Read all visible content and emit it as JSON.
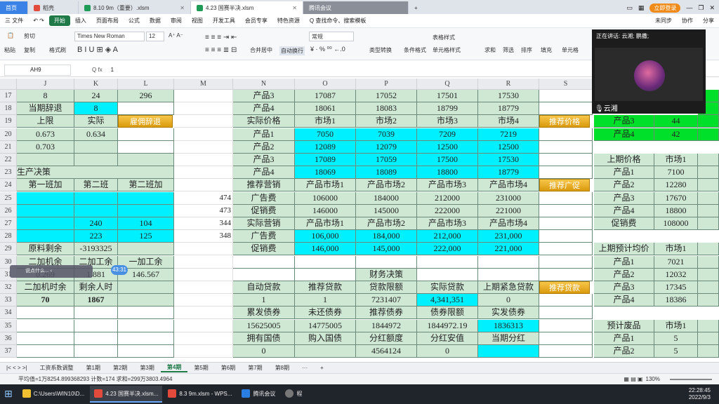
{
  "titlebar": {
    "tabs": [
      {
        "label": "首页"
      },
      {
        "label": "稻壳"
      },
      {
        "label": "8.10 9m（重要）.xlsm"
      },
      {
        "label": "4.23 国赛半决.xlsm"
      },
      {
        "label": "腾讯会议"
      }
    ],
    "login_label": "立即登录"
  },
  "menubar": {
    "items": [
      "三 文件",
      "开始",
      "插入",
      "页面布局",
      "公式",
      "数据",
      "审阅",
      "视图",
      "开发工具",
      "会员专享",
      "特色资源",
      "Q 查找命令、搜索模板",
      "未同步",
      "协作",
      "分享"
    ]
  },
  "ribbon": {
    "font_name": "Times New Roman",
    "font_size": "12",
    "number_format": "常规",
    "labels": [
      "剪切",
      "复制",
      "格式刷",
      "粘贴",
      "合并居中",
      "自动换行",
      "条件格式",
      "表格样式",
      "单元格样式",
      "求和",
      "筛选",
      "排序",
      "填充",
      "单元格",
      "类型转换"
    ]
  },
  "formula": {
    "cell_ref": "AH9",
    "value": "1"
  },
  "columns": [
    "J",
    "K",
    "L",
    "M",
    "N",
    "O",
    "P",
    "Q",
    "R",
    "S"
  ],
  "rows": [
    "17",
    "18",
    "19",
    "20",
    "21",
    "22",
    "23",
    "24",
    "25",
    "26",
    "27",
    "28",
    "29",
    "30",
    "31",
    "32",
    "33",
    "34",
    "35",
    "36",
    "37"
  ],
  "cells": {
    "J17": "8",
    "K17": "24",
    "L17": "296",
    "N17": "产品3",
    "O17": "17087",
    "P17": "17052",
    "Q17": "17501",
    "R17": "17530",
    "J18": "当期辞退",
    "K18": "8",
    "N18": "产品4",
    "O18": "18061",
    "P18": "18083",
    "Q18": "18799",
    "R18": "18779",
    "J19": "上限",
    "K19": "实际",
    "N19": "实际价格",
    "O19": "市场1",
    "P19": "市场2",
    "Q19": "市场3",
    "R19": "市场4",
    "J20": "0.673",
    "K20": "0.634",
    "N20": "产品1",
    "O20": "7050",
    "P20": "7039",
    "Q20": "7209",
    "R20": "7219",
    "J21": "0.703",
    "N21": "产品2",
    "O21": "12089",
    "P21": "12079",
    "Q21": "12500",
    "R21": "12500",
    "N22": "产品3",
    "O22": "17089",
    "P22": "17059",
    "Q22": "17500",
    "R22": "17530",
    "J23": "生产决策",
    "N23": "产品4",
    "O23": "18069",
    "P23": "18089",
    "Q23": "18800",
    "R23": "18779",
    "J24": "第一班加",
    "K24": "第二班",
    "L24": "第二班加",
    "N24": "推荐营销",
    "O24": "产品市场1",
    "P24": "产品市场2",
    "Q24": "产品市场3",
    "R24": "产品市场4",
    "M25": "474",
    "N25": "广告费",
    "O25": "106000",
    "P25": "184000",
    "Q25": "212000",
    "R25": "231000",
    "M26": "473",
    "N26": "促销费",
    "O26": "146000",
    "P26": "145000",
    "Q26": "222000",
    "R26": "221000",
    "K27": "240",
    "L27": "104",
    "M27": "344",
    "N27": "实际营销",
    "O27": "产品市场1",
    "P27": "产品市场2",
    "Q27": "产品市场3",
    "R27": "产品市场4",
    "K28": "223",
    "L28": "125",
    "M28": "348",
    "N28": "广告费",
    "O28": "106,000",
    "P28": "184,000",
    "Q28": "212,000",
    "R28": "231,000",
    "J29": "原料剩余",
    "K29": "-3193325",
    "N29": "促销费",
    "O29": "146,000",
    "P29": "145,000",
    "Q29": "222,000",
    "R29": "221,000",
    "J30": "二加机余",
    "K30": "二加工余",
    "L30": "一加工余",
    "J31": "0.269",
    "K31": "1.881",
    "L31": "146.567",
    "P31": "财务决策",
    "J32": "二加机时余",
    "K32": "剩余人时",
    "N32": "自动贷款",
    "O32": "推荐贷款",
    "P32": "贷款限额",
    "Q32": "实际贷款",
    "R32": "上期紧急贷款",
    "J33": "70",
    "K33": "1867",
    "N33": "1",
    "O33": "1",
    "P33": "7231407",
    "Q33": "4,341,351",
    "R33": "0",
    "N34": "累发债券",
    "O34": "未还债券",
    "P34": "推荐债券",
    "Q34": "债券限额",
    "R34": "实发债券",
    "N35": "15625005",
    "O35": "14775005",
    "P35": "1844972",
    "Q35": "1844972.19",
    "R35": "1836313",
    "N36": "拥有国债",
    "O36": "购入国债",
    "P36": "分红额度",
    "Q36": "分红安值",
    "R36": "当期分红",
    "N37": "0",
    "P37": "4564124",
    "Q37": "0"
  },
  "buttons": {
    "hire_fire": "雇佣辞退",
    "recommend_price": "推荐价格",
    "recommend_promo": "推荐广促",
    "recommend_loan": "推荐贷款"
  },
  "right_panel": {
    "t1": {
      "label": "产品3",
      "v1": "44"
    },
    "t2": {
      "label": "产品4",
      "v1": "42"
    },
    "price_header": [
      "上期价格",
      "市场1"
    ],
    "price_rows": [
      [
        "产品1",
        "7100"
      ],
      [
        "产品2",
        "12280"
      ],
      [
        "产品3",
        "17670"
      ],
      [
        "产品4",
        "18800"
      ],
      [
        "促销费",
        "108000"
      ]
    ],
    "avg_header": [
      "上期预计均价",
      "市场1"
    ],
    "avg_rows": [
      [
        "产品1",
        "7021"
      ],
      [
        "产品2",
        "12032"
      ],
      [
        "产品3",
        "17345"
      ],
      [
        "产品4",
        "18386"
      ]
    ],
    "waste_header": [
      "预计废品",
      "市场1"
    ],
    "waste_rows": [
      [
        "产品1",
        "5"
      ],
      [
        "产品2",
        "5"
      ]
    ]
  },
  "video": {
    "title": "正在讲话: 云湘; 鹏撒;",
    "name": "云湘"
  },
  "overlay": {
    "chat_hint": "说点什么...",
    "timer": "43:31"
  },
  "sheet_tabs": [
    "工资系数调整",
    "第1期",
    "第2期",
    "第3期",
    "第4期",
    "第5期",
    "第6期",
    "第7期",
    "第8期",
    "···",
    "+"
  ],
  "active_sheet": "第4期",
  "status": {
    "text": "平均值=1万8254.899368293  计数=174  求和=299万3803.4964",
    "zoom": "130%"
  },
  "taskbar": {
    "items": [
      "C:\\Users\\WIN10\\D...",
      "4.23 国赛半决.xlsm...",
      "8.3 9m.xlsm - WPS...",
      "腾讯会议",
      "程"
    ],
    "time": "22:28:45",
    "date": "2022/9/3"
  }
}
